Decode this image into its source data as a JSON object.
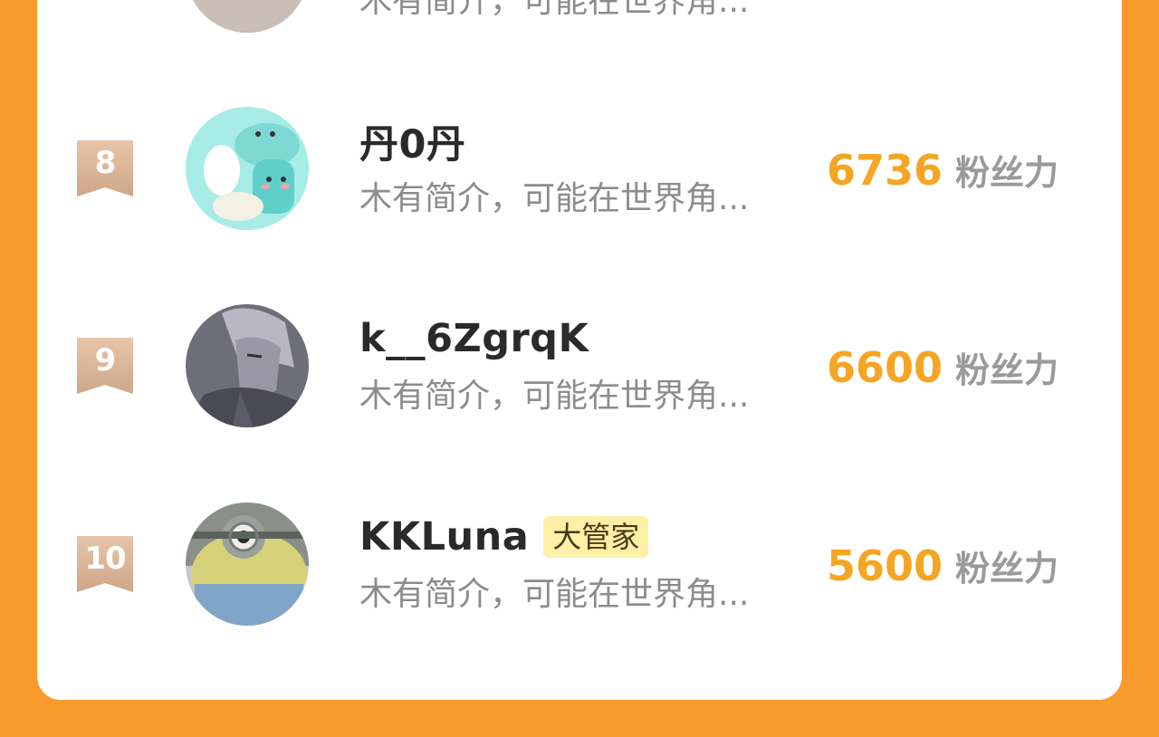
{
  "score_unit": "粉丝力",
  "default_desc": "木有简介，可能在世界角...",
  "rows": [
    {
      "rank": "",
      "name": "",
      "tag": "",
      "desc": "木有简介，可能在世界角...",
      "score": ""
    },
    {
      "rank": "8",
      "name": "丹0丹",
      "tag": "",
      "desc": "木有简介，可能在世界角...",
      "score": "6736",
      "avatar": "cartoon-plush-avatar"
    },
    {
      "rank": "9",
      "name": "k__6ZgrqK",
      "tag": "",
      "desc": "木有简介，可能在世界角...",
      "score": "6600",
      "avatar": "anime-character-avatar"
    },
    {
      "rank": "10",
      "name": "KKLuna",
      "tag": "大管家",
      "desc": "木有简介，可能在世界角...",
      "score": "5600",
      "avatar": "minion-toy-avatar"
    }
  ],
  "colors": {
    "background": "#F99B2C",
    "score": "#F5A523",
    "rank_badge": "#D8B294",
    "tag_bg": "#FFF0A8"
  }
}
